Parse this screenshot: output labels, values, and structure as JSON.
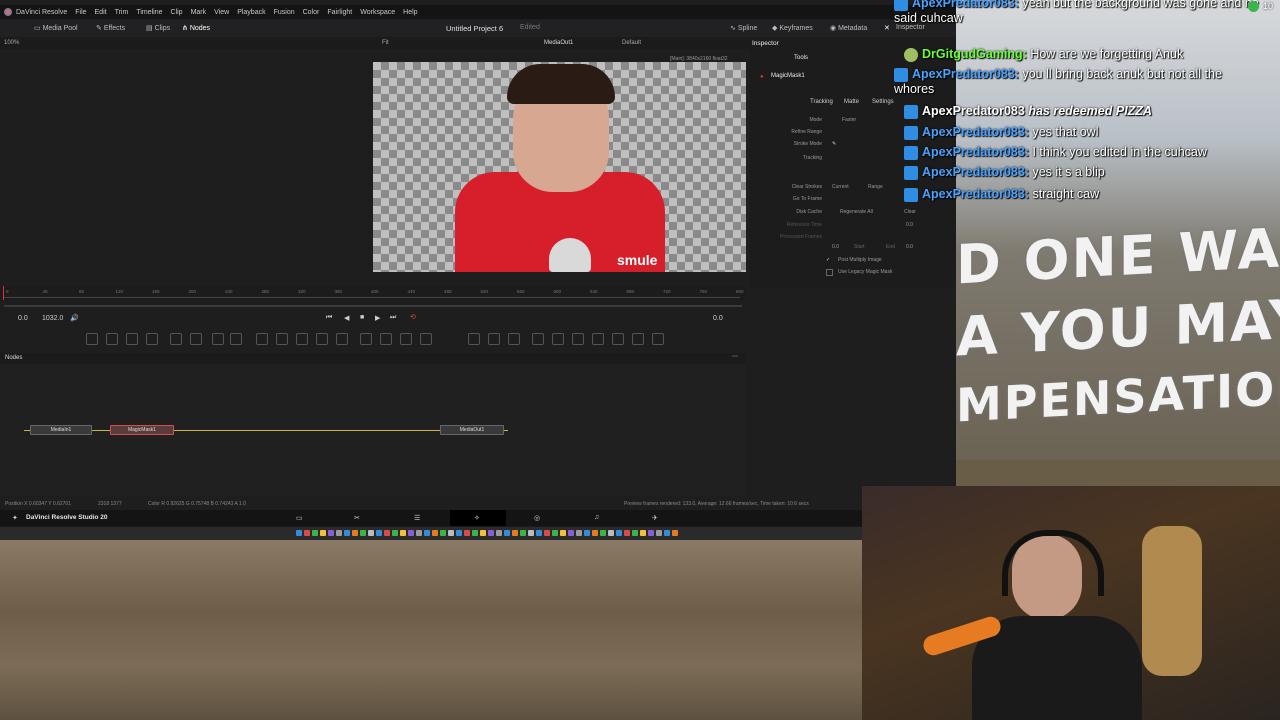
{
  "menu": [
    "DaVinci Resolve",
    "File",
    "Edit",
    "Trim",
    "Timeline",
    "Clip",
    "Mark",
    "View",
    "Playback",
    "Fusion",
    "Color",
    "Fairlight",
    "Workspace",
    "Help"
  ],
  "toolbar": {
    "media_pool": "Media Pool",
    "effects": "Effects",
    "clips": "Clips",
    "nodes": "Nodes",
    "project_title": "Untitled Project 6",
    "edited": "Edited",
    "spline": "Spline",
    "keyframes": "Keyframes",
    "metadata": "Metadata",
    "inspector": "Inspector"
  },
  "viewer": {
    "zoom": "100%",
    "fit": "Fit",
    "output": "MediaOut1",
    "default_label": "Default",
    "info": "[Main]: 3840x2160 float32",
    "watermark": "smule"
  },
  "transport": {
    "start": "0.0",
    "end": "1032.0",
    "current": "0.0"
  },
  "timeline": {
    "ticks": [
      "0",
      "40",
      "80",
      "120",
      "160",
      "200",
      "240",
      "280",
      "320",
      "360",
      "400",
      "440",
      "480",
      "520",
      "560",
      "600",
      "640",
      "680",
      "720",
      "760",
      "800"
    ]
  },
  "nodes": {
    "header": "Nodes",
    "items": [
      {
        "label": "MediaIn1"
      },
      {
        "label": "MagicMask1"
      },
      {
        "label": "MediaOut1"
      }
    ]
  },
  "status": {
    "position": "Position  X 0.60347   Y 0.62701",
    "pixel": "2318    1377",
    "color": "Color  R 0.92625   G 0.75748   B 0.74243   A 1.0",
    "render": "Preview frames rendered: 133.0,  Average: 12.66 frames/sec,  Time taken: 10.6 secs"
  },
  "pagebar": {
    "app": "DaVinci Resolve Studio 20"
  },
  "inspector": {
    "title": "Inspector",
    "tools_tab": "Tools",
    "node_name": "MagicMask1",
    "tabs": [
      "Tracking",
      "Matte",
      "Settings"
    ],
    "mode_label": "Mode",
    "mode_value": "Faster",
    "refine_range": "Refine Range",
    "stroke_mode": "Stroke Mode",
    "tracking": "Tracking",
    "clear_strokes": "Clear Strokes",
    "current": "Current",
    "range": "Range",
    "go_to_frame": "Go To Frame",
    "disk_cache": "Disk Cache",
    "regenerate_all": "Regenerate All",
    "clear": "Clear",
    "reference_time": "Reference Time",
    "reference_value": "0.0",
    "processed_frames": "Processed Frames",
    "start_value": "0.0",
    "start_label": "Start",
    "end_label": "End",
    "end_value": "0.0",
    "post_multiply": "Post Multiply Image",
    "legacy": "Use Legacy Magic Mask"
  },
  "chat": [
    {
      "name": "ApexPredator083",
      "text": "yeah but the background was gone and he said cuhcaw",
      "color": "#4aa3ff"
    },
    {
      "name": "DrGitgudGaming",
      "text": "How are we forgetting Anuk",
      "color": "#6bff3a"
    },
    {
      "name": "ApexPredator083",
      "text": "you ll bring back anuk but not all the whores",
      "color": "#4aa3ff"
    },
    {
      "name": "ApexPredator083",
      "text": "has redeemed PIZZA",
      "color": "#ffffff",
      "italic": true
    },
    {
      "name": "ApexPredator083",
      "text": "yes that owl",
      "color": "#4aa3ff"
    },
    {
      "name": "ApexPredator083",
      "text": "I think you edited in the cuhcaw",
      "color": "#4aa3ff"
    },
    {
      "name": "ApexPredator083",
      "text": "yes it s a blip",
      "color": "#4aa3ff"
    },
    {
      "name": "ApexPredator083",
      "text": "straight caw",
      "color": "#4aa3ff"
    }
  ],
  "sign": [
    "D ONE WAS",
    "A YOU MAY",
    "MPENSATION"
  ],
  "corner_counter": "10"
}
